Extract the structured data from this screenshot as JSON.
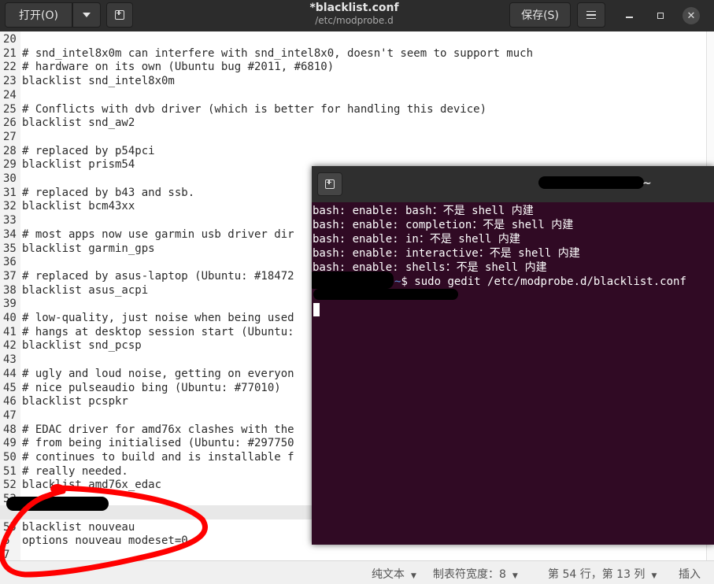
{
  "header": {
    "open_label": "打开(O)",
    "title": "*blacklist.conf",
    "subtitle": "/etc/modprobe.d",
    "save_label": "保存(S)",
    "close_glyph": "✕"
  },
  "editor_lines": [
    {
      "n": "20",
      "t": ""
    },
    {
      "n": "21",
      "t": "# snd_intel8x0m can interfere with snd_intel8x0, doesn't seem to support much"
    },
    {
      "n": "22",
      "t": "# hardware on its own (Ubuntu bug #2011, #6810)"
    },
    {
      "n": "23",
      "t": "blacklist snd_intel8x0m"
    },
    {
      "n": "24",
      "t": ""
    },
    {
      "n": "25",
      "t": "# Conflicts with dvb driver (which is better for handling this device)"
    },
    {
      "n": "26",
      "t": "blacklist snd_aw2"
    },
    {
      "n": "27",
      "t": ""
    },
    {
      "n": "28",
      "t": "# replaced by p54pci"
    },
    {
      "n": "29",
      "t": "blacklist prism54"
    },
    {
      "n": "30",
      "t": ""
    },
    {
      "n": "31",
      "t": "# replaced by b43 and ssb."
    },
    {
      "n": "32",
      "t": "blacklist bcm43xx"
    },
    {
      "n": "33",
      "t": ""
    },
    {
      "n": "34",
      "t": "# most apps now use garmin usb driver dir"
    },
    {
      "n": "35",
      "t": "blacklist garmin_gps"
    },
    {
      "n": "36",
      "t": ""
    },
    {
      "n": "37",
      "t": "# replaced by asus-laptop (Ubuntu: #18472"
    },
    {
      "n": "38",
      "t": "blacklist asus_acpi"
    },
    {
      "n": "39",
      "t": ""
    },
    {
      "n": "40",
      "t": "# low-quality, just noise when being used"
    },
    {
      "n": "41",
      "t": "# hangs at desktop session start (Ubuntu:"
    },
    {
      "n": "42",
      "t": "blacklist snd_pcsp"
    },
    {
      "n": "43",
      "t": ""
    },
    {
      "n": "44",
      "t": "# ugly and loud noise, getting on everyon"
    },
    {
      "n": "45",
      "t": "# nice pulseaudio bing (Ubuntu: #77010)"
    },
    {
      "n": "46",
      "t": "blacklist pcspkr"
    },
    {
      "n": "47",
      "t": ""
    },
    {
      "n": "48",
      "t": "# EDAC driver for amd76x clashes with the"
    },
    {
      "n": "49",
      "t": "# from being initialised (Ubuntu: #297750"
    },
    {
      "n": "50",
      "t": "# continues to build and is installable f"
    },
    {
      "n": "51",
      "t": "# really needed."
    },
    {
      "n": "52",
      "t": "blacklist amd76x_edac"
    },
    {
      "n": "53",
      "t": ""
    },
    {
      "n": "",
      "t": ""
    },
    {
      "n": "55",
      "t": "blacklist nouveau"
    },
    {
      "n": "6",
      "t": "options nouveau modeset=0"
    },
    {
      "n": "7",
      "t": ""
    }
  ],
  "statusbar": {
    "lang": "纯文本",
    "tab_width": "制表符宽度：8",
    "position": "第 54 行，第 13 列",
    "mode": "插入"
  },
  "terminal": {
    "title_suffix": "~",
    "lines": [
      "bash: enable: bash：不是 shell 内建",
      "bash: enable: completion：不是 shell 内建",
      "bash: enable: in：不是 shell 内建",
      "bash: enable: interactive：不是 shell 内建",
      "bash: enable: shells：不是 shell 内建"
    ],
    "prompt_path": "~",
    "command": "$ sudo gedit /etc/modprobe.d/blacklist.conf"
  },
  "icons": {
    "dropdown": "chevron-down-icon",
    "new_tab": "new-tab-icon",
    "menu": "hamburger-menu-icon",
    "minimize": "minimize-icon",
    "maximize": "maximize-icon",
    "close": "close-icon"
  },
  "colors": {
    "terminal_bg": "#300a24",
    "header_bg": "#2c2c2c",
    "annotation_red": "#ff0000"
  }
}
